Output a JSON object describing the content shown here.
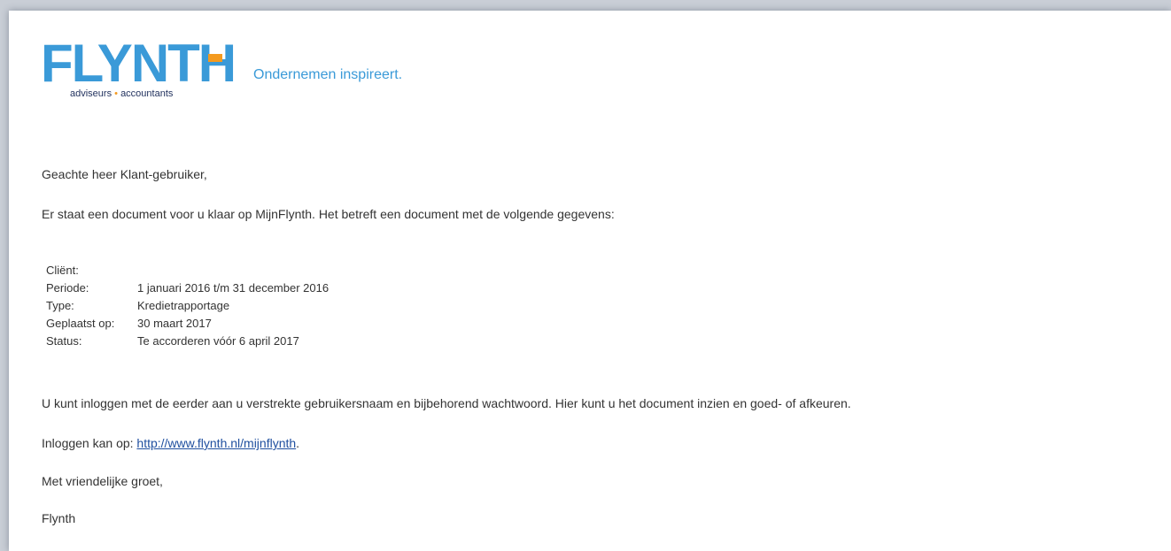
{
  "logo": {
    "wordmark": "FLYNTH",
    "subtitle_left": "adviseurs",
    "subtitle_dot": "•",
    "subtitle_right": "accountants",
    "tagline": "Ondernemen inspireert."
  },
  "email": {
    "greeting": "Geachte heer Klant-gebruiker,",
    "intro": "Er staat een document voor u klaar op MijnFlynth. Het betreft een document met de volgende gegevens:",
    "details": [
      {
        "label": "Cliënt:",
        "value": ""
      },
      {
        "label": "Periode:",
        "value": "1 januari 2016 t/m 31 december 2016"
      },
      {
        "label": "Type:",
        "value": "Kredietrapportage"
      },
      {
        "label": "Geplaatst op:",
        "value": "30 maart 2017"
      },
      {
        "label": "Status:",
        "value": "Te accorderen vóór 6 april 2017"
      }
    ],
    "login_text": "U kunt inloggen met de eerder aan u verstrekte gebruikersnaam en bijbehorend wachtwoord. Hier kunt u het document inzien en goed- of afkeuren.",
    "link_prefix": "Inloggen kan op: ",
    "link_text": "http://www.flynth.nl/mijnflynth",
    "link_suffix": ".",
    "closing": "Met vriendelijke groet,",
    "signature": "Flynth"
  },
  "colors": {
    "brand_blue": "#3a9ad8",
    "brand_orange": "#f49a1f",
    "brand_navy": "#1f2f5c",
    "link": "#1f4f9f",
    "text": "#333333"
  }
}
